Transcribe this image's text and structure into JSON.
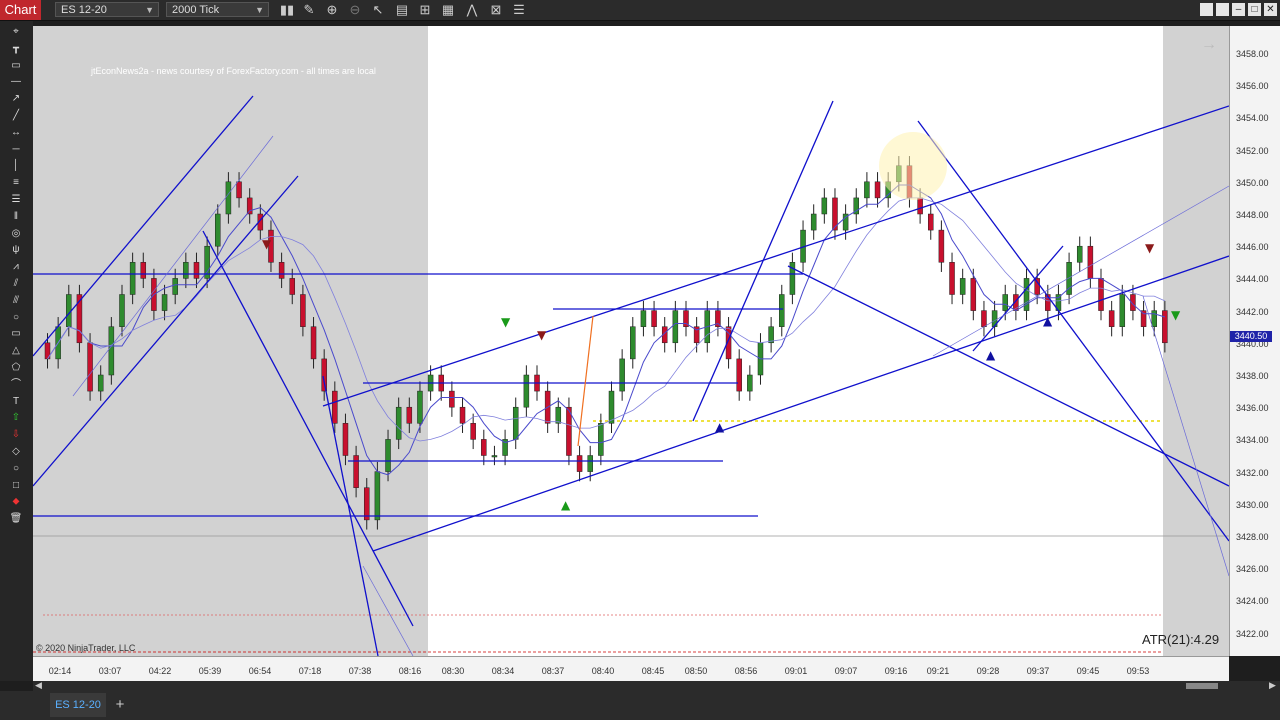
{
  "window": {
    "app_label": "Chart",
    "instrument": "ES 12-20",
    "interval": "2000 Tick"
  },
  "toolbar": {
    "icons": [
      "bar-type-icon",
      "pencil-icon",
      "zoom-in-icon",
      "zoom-out-icon",
      "pointer-icon",
      "properties-icon",
      "data-series-icon",
      "strategy-icon",
      "indicators-icon",
      "list-icon"
    ]
  },
  "drawing_tools": [
    "cursor-icon",
    "ruler-icon",
    "risk-reward-icon",
    "line-icon",
    "ray-icon",
    "extended-line-icon",
    "arrow-line-icon",
    "horizontal-line-icon",
    "vertical-line-icon",
    "fib-retracement-icon",
    "fib-extension-icon",
    "fib-time-icon",
    "fib-circle-icon",
    "andrews-pitchfork-icon",
    "gann-fan-icon",
    "regression-channel-icon",
    "trend-channel-icon",
    "ellipse-icon",
    "rectangle-icon",
    "triangle-icon",
    "polygon-icon",
    "arc-icon",
    "text-icon",
    "arrow-up-icon",
    "arrow-down-icon",
    "diamond-icon",
    "dot-icon",
    "square-icon",
    "stop-icon",
    "trash-icon"
  ],
  "chart": {
    "news_text": "jtEconNews2a - news courtesy of ForexFactory.com - all times are local",
    "copyright": "© 2020 NinjaTrader, LLC",
    "atr_label": "ATR(21):4.29",
    "price_ticks": [
      "3458.00",
      "3456.00",
      "3454.00",
      "3452.00",
      "3450.00",
      "3448.00",
      "3446.00",
      "3444.00",
      "3442.00",
      "3440.00",
      "3438.00",
      "3436.00",
      "3434.00",
      "3432.00",
      "3430.00",
      "3428.00",
      "3426.00",
      "3424.00",
      "3422.00"
    ],
    "current_price": "3440.50",
    "time_ticks": [
      "02:14",
      "03:07",
      "04:22",
      "05:39",
      "06:54",
      "07:18",
      "07:38",
      "08:16",
      "08:30",
      "08:34",
      "08:37",
      "08:40",
      "08:45",
      "08:50",
      "08:56",
      "09:01",
      "09:07",
      "09:16",
      "09:21",
      "09:28",
      "09:37",
      "09:45",
      "09:53"
    ],
    "colors": {
      "up_candle": "#2e8b2e",
      "down_candle": "#c8102e",
      "trendline": "#1010cc",
      "shade": "#d2d2d2",
      "price_flag": "#1f23a8"
    }
  },
  "tabs": {
    "active": "ES 12-20",
    "add": "+"
  }
}
